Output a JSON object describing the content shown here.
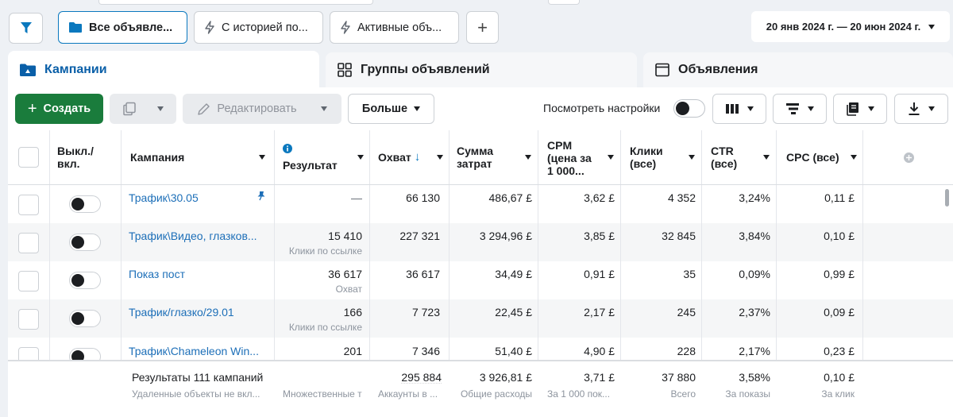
{
  "topbar": {
    "chips": [
      {
        "label": "Все объявле...",
        "icon": "folder-icon",
        "active": true
      },
      {
        "label": "С историей по...",
        "icon": "lightning-icon",
        "active": false
      },
      {
        "label": "Активные объ...",
        "icon": "lightning-icon",
        "active": false
      }
    ],
    "add_label": "+",
    "date_range": "20 янв 2024 г. — 20 июн 2024 г."
  },
  "tabs": {
    "campaigns": "Кампании",
    "adsets": "Группы объявлений",
    "ads": "Объявления"
  },
  "toolbar": {
    "create": "Создать",
    "edit": "Редактировать",
    "more": "Больше",
    "view_settings": "Посмотреть настройки"
  },
  "columns": {
    "toggle": "Выкл./ вкл.",
    "campaign": "Кампания",
    "result": "Результат",
    "reach": "Охват",
    "spend": "Сумма затрат",
    "cpm": "CPM (цена за 1 000...",
    "clicks": "Клики (все)",
    "ctr": "CTR (все)",
    "cpc": "CPC (все)"
  },
  "rows": [
    {
      "name": "Трафик\\30.05",
      "pinned": true,
      "result": "—",
      "result_sub": "",
      "reach": "66 130",
      "spend": "486,67 £",
      "cpm": "3,62 £",
      "clicks": "4 352",
      "ctr": "3,24%",
      "cpc": "0,11 £"
    },
    {
      "name": "Трафик\\Видео, глазков...",
      "pinned": false,
      "result": "15 410",
      "result_sub": "Клики по ссылке",
      "reach": "227 321",
      "spend": "3 294,96 £",
      "cpm": "3,85 £",
      "clicks": "32 845",
      "ctr": "3,84%",
      "cpc": "0,10 £"
    },
    {
      "name": "Показ пост",
      "pinned": false,
      "result": "36 617",
      "result_sub": "Охват",
      "reach": "36 617",
      "spend": "34,49 £",
      "cpm": "0,91 £",
      "clicks": "35",
      "ctr": "0,09%",
      "cpc": "0,99 £"
    },
    {
      "name": "Трафик/глазко/29.01",
      "pinned": false,
      "result": "166",
      "result_sub": "Клики по ссылке",
      "reach": "7 723",
      "spend": "22,45 £",
      "cpm": "2,17 £",
      "clicks": "245",
      "ctr": "2,37%",
      "cpc": "0,09 £"
    },
    {
      "name": "Трафик\\Chameleon Win...",
      "pinned": false,
      "result": "201",
      "result_sub": "",
      "reach": "7 346",
      "spend": "51,40 £",
      "cpm": "4,90 £",
      "clicks": "228",
      "ctr": "2,17%",
      "cpc": "0,23 £"
    }
  ],
  "footer": {
    "title": "Результаты 111 кампаний",
    "title_sub": "Удаленные объекты не вкл...",
    "result_sub": "Множественные т",
    "reach": "295 884",
    "reach_sub": "Аккаунты в ...",
    "spend": "3 926,81 £",
    "spend_sub": "Общие расходы",
    "cpm": "3,71 £",
    "cpm_sub": "За 1 000 пок...",
    "clicks": "37 880",
    "clicks_sub": "Всего",
    "ctr": "3,58%",
    "ctr_sub": "За показы",
    "cpc": "0,10 £",
    "cpc_sub": "За клик"
  },
  "colors": {
    "accent_blue": "#0a78be",
    "create_green": "#1a7c3c",
    "link_blue": "#1d6fb8"
  }
}
